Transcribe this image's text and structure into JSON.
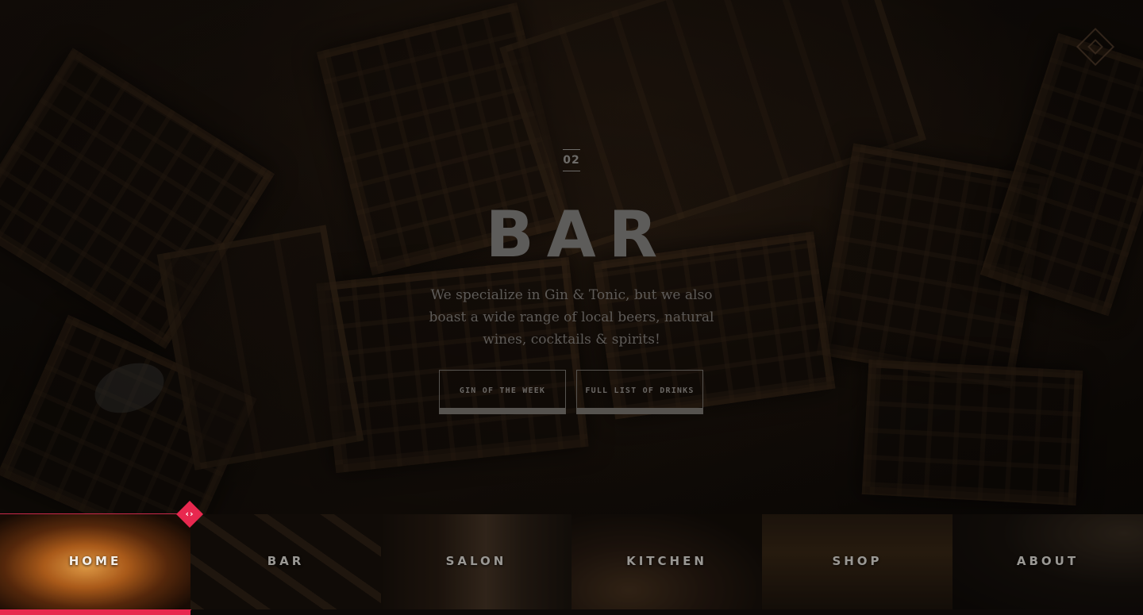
{
  "hero": {
    "section_number": "02",
    "title": "BAR",
    "description": "We specialize in Gin & Tonic, but we also boast a wide range of local beers, natural wines, cocktails & spirits!",
    "buttons": {
      "gin_of_the_week": "GIN OF THE WEEK",
      "full_list_of_drinks": "FULL LIST OF DRINKS"
    }
  },
  "nav": {
    "arrows_glyph": "‹›",
    "active_color": "#e8284f",
    "items": [
      {
        "label": "HOME",
        "active": true
      },
      {
        "label": "BAR",
        "active": false
      },
      {
        "label": "SALON",
        "active": false
      },
      {
        "label": "KITCHEN",
        "active": false
      },
      {
        "label": "SHOP",
        "active": false
      },
      {
        "label": "ABOUT",
        "active": false
      }
    ]
  }
}
